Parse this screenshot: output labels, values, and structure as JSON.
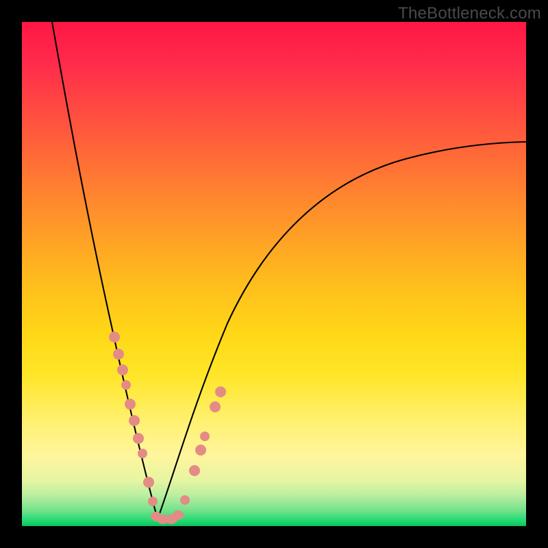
{
  "watermark": "TheBottleneck.com",
  "chart_data": {
    "type": "line",
    "title": "",
    "xlabel": "",
    "ylabel": "",
    "xlim": [
      0,
      100
    ],
    "ylim": [
      0,
      100
    ],
    "grid": false,
    "legend": false,
    "note": "Two smooth curves descending from top toward a minimum near x≈27 at y≈0, then the right curve rises again toward ~y≈77 at x=100. Small salmon-colored data points cluster along both curve branches near the bottom, with a short horizontal cluster at the minimum.",
    "series": [
      {
        "name": "left-branch",
        "x": [
          6,
          8,
          10,
          12,
          14,
          16,
          18,
          20,
          22,
          24,
          26,
          27
        ],
        "y": [
          100,
          92,
          84,
          75,
          66,
          56,
          46,
          35,
          24,
          13,
          4,
          1
        ]
      },
      {
        "name": "right-branch",
        "x": [
          27,
          29,
          32,
          36,
          40,
          45,
          50,
          56,
          62,
          70,
          78,
          86,
          94,
          100
        ],
        "y": [
          1,
          5,
          14,
          26,
          36,
          44,
          51,
          57,
          62,
          67,
          71,
          74,
          76,
          77
        ]
      }
    ],
    "points": {
      "name": "data-dots",
      "note": "salmon dots along lower portions of both branches and along the trough",
      "x": [
        16.0,
        17.0,
        17.7,
        18.5,
        19.6,
        20.5,
        21.4,
        22.3,
        24.0,
        25.3,
        26.0,
        27.0,
        28.0,
        29.0,
        30.0,
        31.0,
        32.5,
        33.5,
        34.0,
        35.8,
        36.8
      ],
      "y": [
        37.0,
        33.5,
        30.5,
        27.5,
        23.8,
        20.5,
        17.0,
        14.0,
        8.0,
        4.0,
        2.2,
        1.2,
        1.2,
        1.4,
        2.2,
        4.3,
        10.5,
        14.5,
        17.0,
        23.0,
        26.0
      ]
    },
    "colors": {
      "curve": "#000000",
      "points": "#e48b85",
      "background_gradient": [
        "#ff1744",
        "#ffd817",
        "#fff59d",
        "#1fd873"
      ]
    }
  }
}
